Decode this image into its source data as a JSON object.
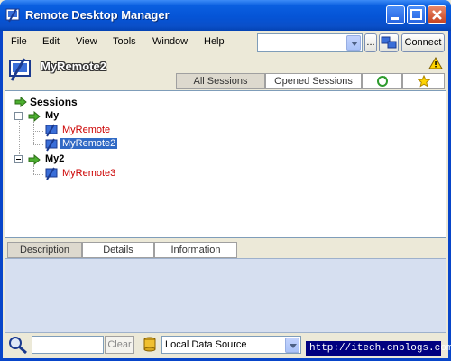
{
  "window": {
    "title": "Remote Desktop Manager"
  },
  "menu": [
    "File",
    "Edit",
    "View",
    "Tools",
    "Window",
    "Help"
  ],
  "toolbar": {
    "ellipsis_label": "...",
    "connect_label": "Connect"
  },
  "session": {
    "name": "MyRemote2"
  },
  "tabs": [
    "All Sessions",
    "Opened Sessions"
  ],
  "tree": {
    "root": "Sessions",
    "groups": [
      {
        "name": "My",
        "items": [
          "MyRemote",
          "MyRemote2"
        ]
      },
      {
        "name": "My2",
        "items": [
          "MyRemote3"
        ]
      }
    ],
    "selected": "MyRemote2"
  },
  "details_tabs": [
    "Description",
    "Details",
    "Information"
  ],
  "status": {
    "clear_label": "Clear",
    "datasource": "Local Data Source",
    "watermark": "http://itech.cnblogs.com/"
  },
  "colors": {
    "accent": "#0554d6",
    "selection": "#316ac5",
    "session_text": "#cc0000",
    "panel": "#d6dff0"
  },
  "icons": [
    "app-icon",
    "minimize-icon",
    "maximize-icon",
    "close-icon",
    "search-icon",
    "datasource-icon",
    "warning-icon",
    "refresh-icon",
    "favorites-icon",
    "arrow-icon",
    "computer-icon"
  ]
}
